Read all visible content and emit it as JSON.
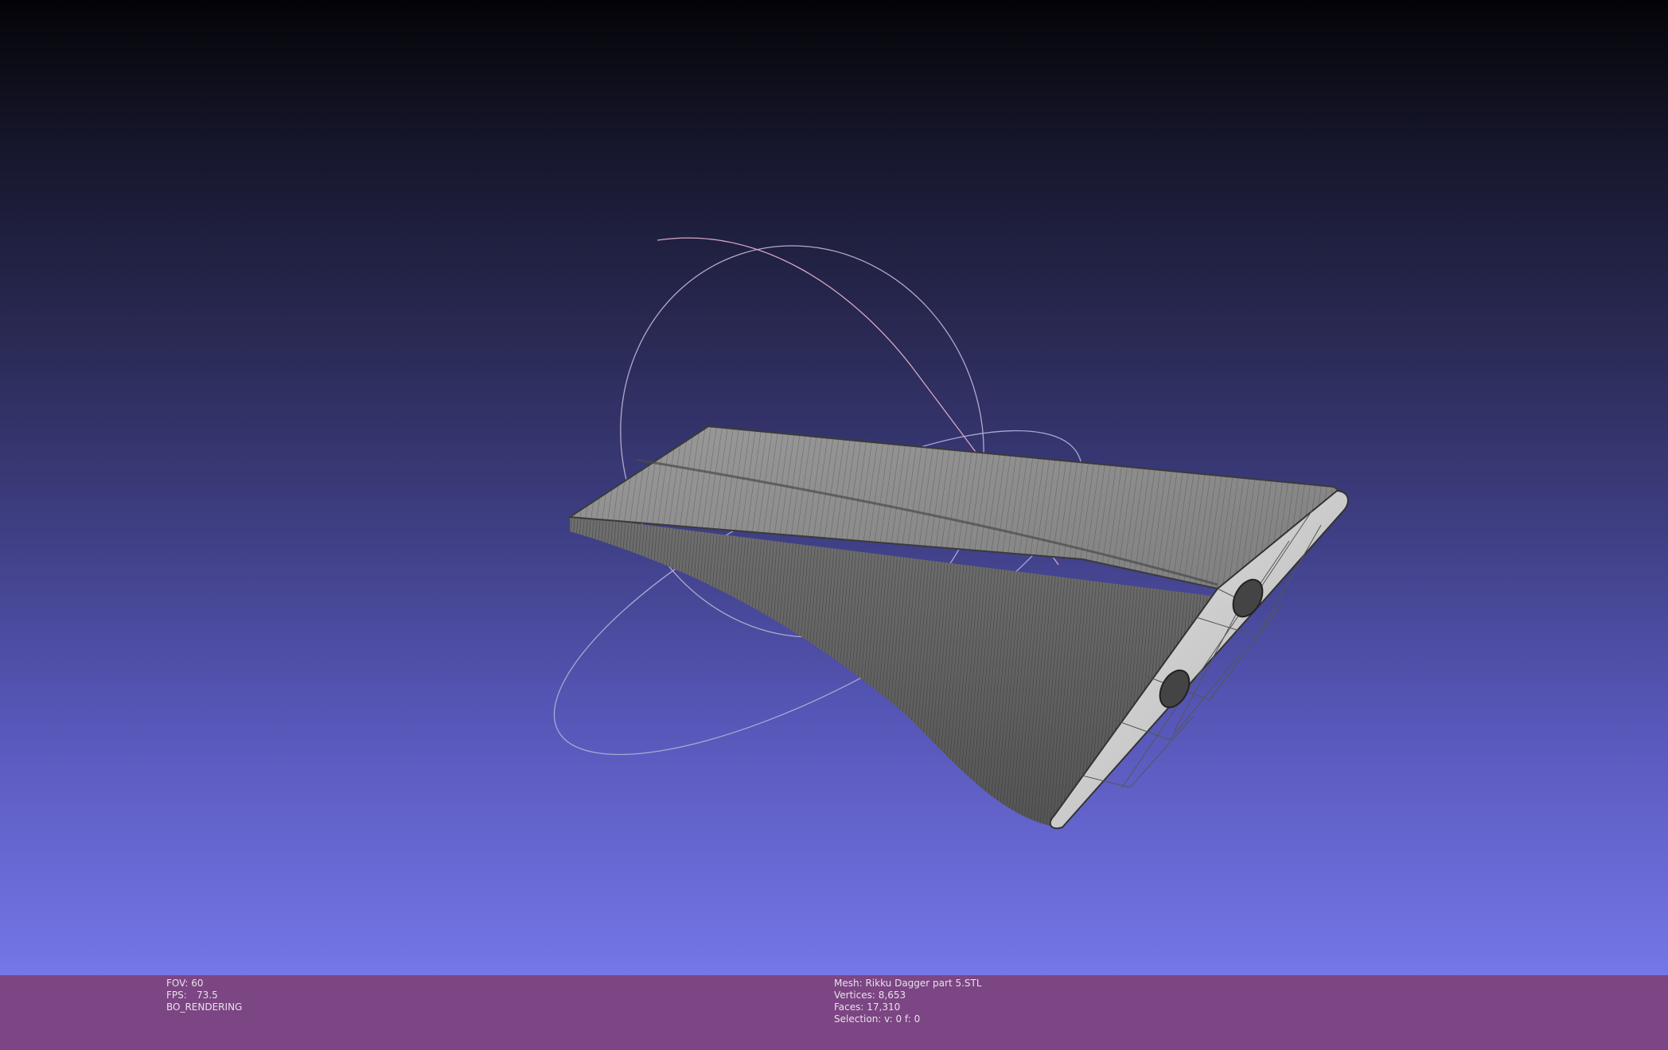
{
  "viewport": {
    "background_top": "#040407",
    "background_bottom": "#7576e8",
    "mesh_color": "#8c8c8c",
    "trackball_colors": [
      "#b2a8c8",
      "#d7a8c0",
      "#9fa6cc"
    ]
  },
  "status": {
    "background": "#7c4583",
    "fov_label": "FOV:",
    "fov_value": "60",
    "fps_label": "FPS:",
    "fps_value": "73.5",
    "render_mode": "BO_RENDERING",
    "mesh_label": "Mesh:",
    "mesh_name": "Rikku Dagger part 5.STL",
    "vertices_label": "Vertices:",
    "vertices_value": "8,653",
    "faces_label": "Faces:",
    "faces_value": "17,310",
    "selection_label": "Selection:",
    "selection_value": "v: 0 f: 0"
  }
}
